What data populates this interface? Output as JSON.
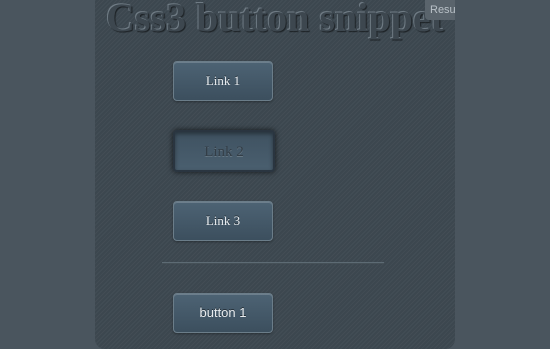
{
  "page": {
    "title": "Css3 button snippet",
    "result_tab_label": "Resu"
  },
  "buttons": {
    "link1_label": "Link 1",
    "link2_label": "Link 2",
    "link3_label": "Link 3",
    "button1_label": "button 1"
  },
  "colors": {
    "page_background": "#4a555e",
    "panel_background": "#3c474f",
    "button_gradient_top": "#4d6374",
    "button_gradient_bottom": "#3c4f5e",
    "button_text": "#e8ecef",
    "pressed_text": "#333e47"
  }
}
